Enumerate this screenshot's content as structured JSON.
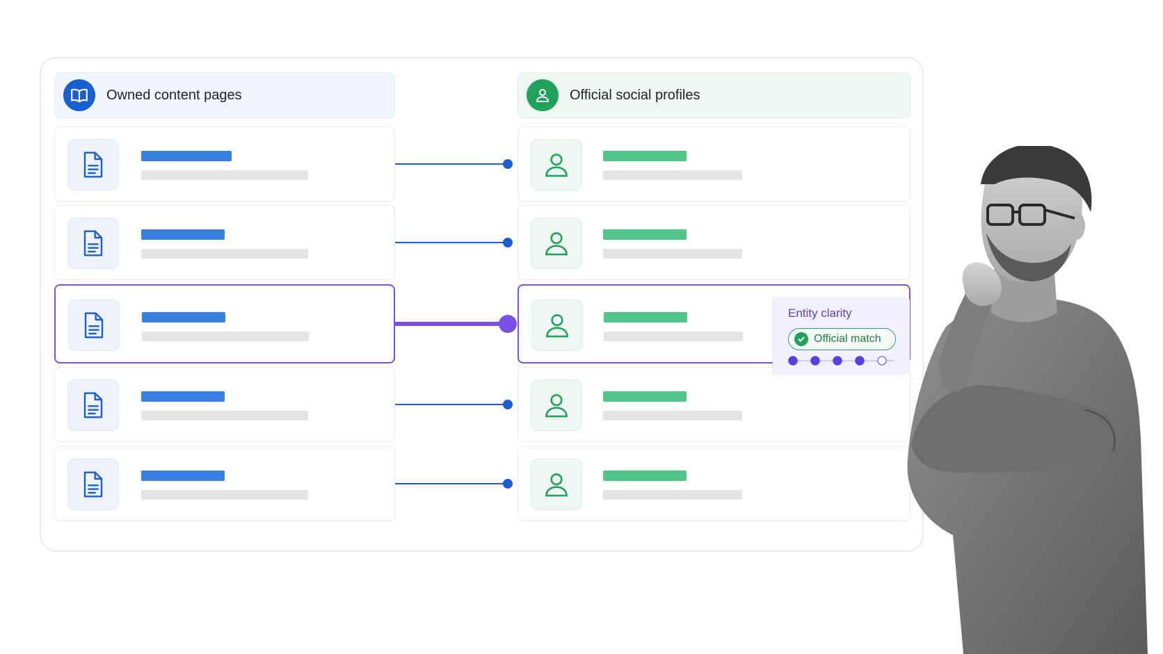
{
  "left_column": {
    "title": "Owned content pages",
    "icon": "open-book-icon",
    "row_icon": "document-icon"
  },
  "right_column": {
    "title": "Official social profiles",
    "icon": "user-icon",
    "row_icon": "user-outline-icon"
  },
  "rows": [
    {
      "active": false
    },
    {
      "active": false
    },
    {
      "active": true
    },
    {
      "active": false
    },
    {
      "active": false
    }
  ],
  "entity_clarity": {
    "title": "Entity clarity",
    "badge_label": "Official match",
    "badge_icon": "check-circle-icon",
    "progress": {
      "filled": 4,
      "total": 5
    }
  },
  "colors": {
    "primary_blue": "#1a5fd0",
    "accent_green": "#1fa35a",
    "highlight_purple": "#7a4fe6"
  },
  "illustration": "thinking-man-photo"
}
